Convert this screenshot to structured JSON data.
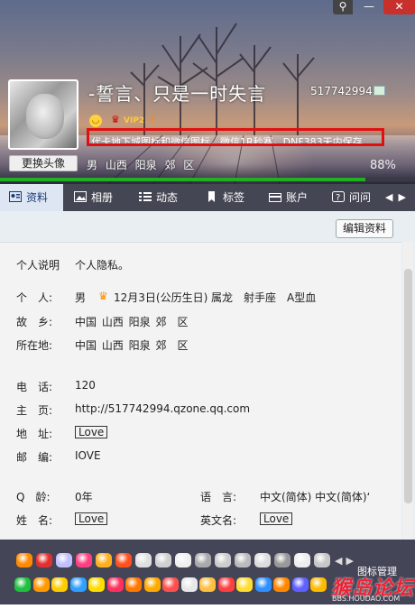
{
  "window": {
    "pin_glyph": "⚲",
    "min_glyph": "—",
    "close_glyph": "✕"
  },
  "profile": {
    "nickname": "-誓言、只是一时失言",
    "qq_number": "517742994",
    "vip_label": "VIP2",
    "vip_arrow": "↑",
    "signature": "代卡地下城图标和微信图标，微信1R秒赛，DNF383天内保存",
    "change_avatar": "更换头像",
    "location_line": "男 山西 阳泉 郊 区",
    "completion": "88%",
    "completion_value": 0.88,
    "progress_color": "#20b020"
  },
  "tabs": [
    {
      "label": "资料",
      "icon": "id-card-icon"
    },
    {
      "label": "相册",
      "icon": "photo-icon"
    },
    {
      "label": "动态",
      "icon": "list-icon"
    },
    {
      "label": "标签",
      "icon": "bookmark-icon"
    },
    {
      "label": "账户",
      "icon": "account-icon"
    },
    {
      "label": "问问",
      "icon": "question-icon"
    }
  ],
  "tab_arrows": "◀▶",
  "content": {
    "edit_button": "编辑资料",
    "fields": {
      "intro_label": "个人说明",
      "intro_value": "个人隐私。",
      "person_label": "个　人:",
      "gender": "男",
      "birthday": "12月3日(公历生日)",
      "zodiac": "属龙",
      "constellation": "射手座",
      "blood": "A型血",
      "hometown_label": "故　乡:",
      "hometown": "中国 山西 阳泉 郊　区",
      "residence_label": "所在地:",
      "residence": "中国 山西 阳泉 郊　区",
      "phone_label": "电　话:",
      "phone": "120",
      "homepage_label": "主　页:",
      "homepage": "http://517742994.qzone.qq.com",
      "address_label": "地　址:",
      "address": "Love",
      "zip_label": "邮　编:",
      "zip": "IOVE",
      "qage_label": "Q　龄:",
      "qage": "0年",
      "language_label": "语　言:",
      "language": "中文(简体) 中文(简体)‘",
      "name_label": "姓　名:",
      "name": "Love",
      "en_name_label": "英文名:",
      "en_name": "Love"
    }
  },
  "emoji_bar": {
    "arrows": "◀▶",
    "manage_label": "图标管理",
    "watermark": "猴岛论坛",
    "watermark_url": "BBS.HOUDAO.COM",
    "row1_colors": [
      "#ff8a00",
      "#e03030",
      "#c0c0ff",
      "#ff4080",
      "#ffb020",
      "#ff5020",
      "#e0e0e0",
      "#d0d0d0",
      "#f0f0f0",
      "#aaaaaa",
      "#cccccc",
      "#bbbbbb",
      "#dddddd",
      "#999999",
      "#eeeeee",
      "#c8c8c8"
    ],
    "row2_colors": [
      "#20c040",
      "#ff9900",
      "#ffcc00",
      "#30a0ff",
      "#ffdd00",
      "#ff3060",
      "#ff7700",
      "#ffaa00",
      "#ff5050",
      "#e8e8e8",
      "#ffc040",
      "#ff4040",
      "#ffdd33",
      "#3090ff",
      "#ff8800",
      "#6060ff",
      "#ffbb00"
    ]
  }
}
